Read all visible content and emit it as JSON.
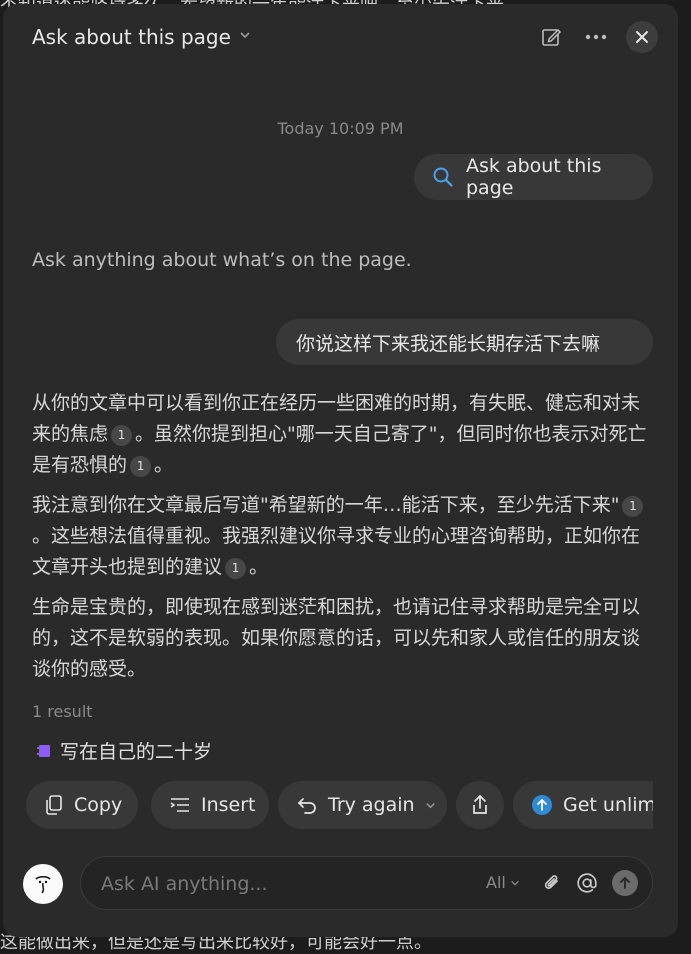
{
  "background": {
    "top_text": "不知道还能坚持多久，希望新的一年能活下来吧，至少先活下来。",
    "bottom_text": "这能做出来，但是还是写出来比较好，可能会好一点。"
  },
  "header": {
    "title": "Ask about this page",
    "chevron_icon": "chevron-down-icon",
    "new_chat_icon": "edit-icon",
    "more_icon": "more-dots-icon",
    "close_icon": "close-icon"
  },
  "conversation": {
    "timestamp": "Today 10:09 PM",
    "context_chip": {
      "icon": "search-icon",
      "label": "Ask about this page"
    },
    "intro": "Ask anything about what’s on the page.",
    "user_message": "你说这样下来我还能长期存活下去嘛",
    "answer": {
      "p1_a": "从你的文章中可以看到你正在经历一些困难的时期，有失眠、健忘和对未来的焦虑",
      "p1_b": "。虽然你提到担心\"哪一天自己寄了\"，但同时你也表示对死亡是有恐惧的",
      "p1_c": "。",
      "p2_a": "我注意到你在文章最后写道\"希望新的一年…能活下来，至少先活下来\"",
      "p2_b": "。这些想法值得重视。我强烈建议你寻求专业的心理咨询帮助，正如你在文章开头也提到的建议",
      "p2_c": "。",
      "p3": "生命是宝贵的，即使现在感到迷茫和困扰，也请记住寻求帮助是完全可以的，这不是软弱的表现。如果你愿意的话，可以先和家人或信任的朋友谈谈你的感受。",
      "citation": "1"
    },
    "results": {
      "count_label": "1 result",
      "items": [
        {
          "icon": "page-icon",
          "title": "写在自己的二十岁"
        }
      ]
    }
  },
  "actions": {
    "copy": "Copy",
    "insert": "Insert",
    "try_again": "Try again",
    "share_icon": "share-icon",
    "upgrade": "Get unlimit"
  },
  "composer": {
    "placeholder": "Ask AI anything...",
    "mode": "All",
    "attach_icon": "paperclip-icon",
    "mention_icon": "at-icon",
    "send_icon": "send-arrow-icon"
  },
  "colors": {
    "panel_bg": "#2a2a2a",
    "chip_bg": "#383838",
    "accent_blue": "#2f8bd6",
    "result_icon_purple": "#8b5cf6"
  }
}
